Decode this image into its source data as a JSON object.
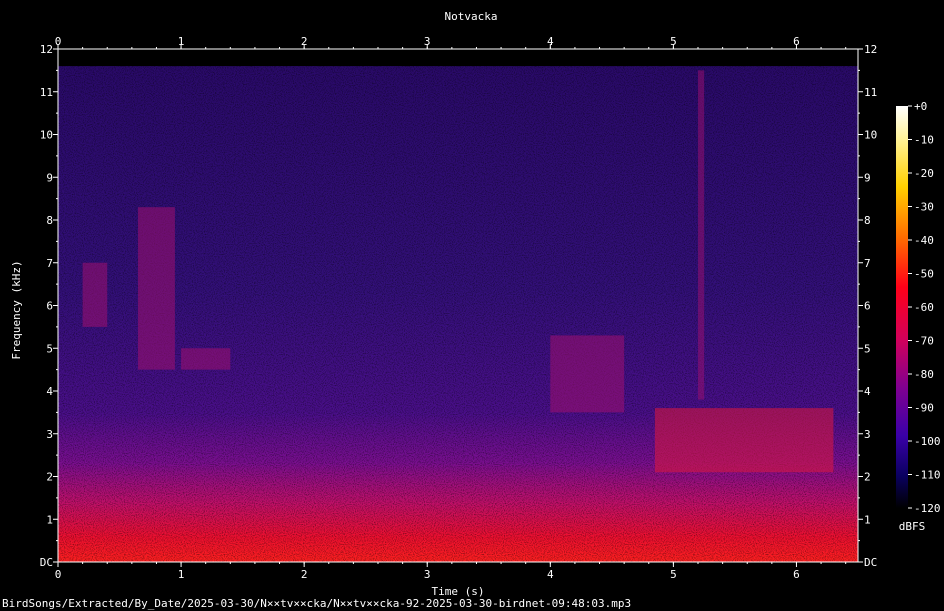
{
  "chart_data": {
    "type": "heatmap",
    "title": "Notvacka",
    "xlabel": "Time (s)",
    "ylabel": "Frequency (kHz)",
    "xlim": [
      0,
      6.5
    ],
    "ylim": [
      0,
      12
    ],
    "x_ticks": [
      "0",
      "1",
      "2",
      "3",
      "4",
      "5",
      "6"
    ],
    "y_ticks": [
      "DC",
      "1",
      "2",
      "3",
      "4",
      "5",
      "6",
      "7",
      "8",
      "9",
      "10",
      "11",
      "12"
    ],
    "colorbar": {
      "label": "dBFS",
      "range": [
        -120,
        0
      ],
      "ticks": [
        "+0",
        "-10",
        "-20",
        "-30",
        "-40",
        "-50",
        "-60",
        "-70",
        "-80",
        "-90",
        "-100",
        "-110",
        "-120"
      ]
    },
    "signal_top_khz": 11.6,
    "events": [
      {
        "t0": 0.2,
        "t1": 0.4,
        "f0": 5.5,
        "f1": 7.0
      },
      {
        "t0": 0.65,
        "t1": 0.95,
        "f0": 4.5,
        "f1": 8.3
      },
      {
        "t0": 1.0,
        "t1": 1.4,
        "f0": 4.5,
        "f1": 5.0
      },
      {
        "t0": 4.0,
        "t1": 4.6,
        "f0": 3.5,
        "f1": 5.3
      },
      {
        "t0": 4.85,
        "t1": 6.3,
        "f0": 2.1,
        "f1": 3.6
      },
      {
        "t0": 5.2,
        "t1": 5.25,
        "f0": 3.8,
        "f1": 11.5
      }
    ]
  },
  "footer": {
    "path": "BirdSongs/Extracted/By_Date/2025-03-30/N××tv××cka/N××tv××cka-92-2025-03-30-birdnet-09:48:03.mp3"
  }
}
